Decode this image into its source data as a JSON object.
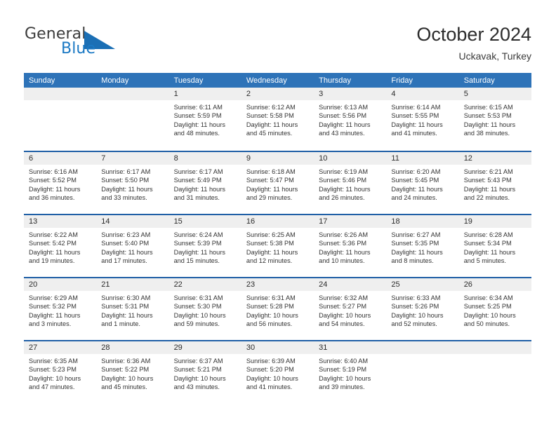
{
  "brand": {
    "name_part1": "General",
    "name_part2": "Blue",
    "logo_icon": "triangle-flag-icon",
    "color_dark": "#3c3c3c",
    "color_blue": "#1b79c4"
  },
  "header": {
    "title": "October 2024",
    "subtitle": "Uckavak, Turkey"
  },
  "theme": {
    "header_bar_bg": "#2E73B8",
    "row_divider": "#1F5FA6",
    "daynum_strip_bg": "#EFEFEF",
    "text": "#333333"
  },
  "calendar": {
    "weekday_headers": [
      "Sunday",
      "Monday",
      "Tuesday",
      "Wednesday",
      "Thursday",
      "Friday",
      "Saturday"
    ],
    "weeks": [
      [
        {
          "day": "",
          "lines": []
        },
        {
          "day": "",
          "lines": []
        },
        {
          "day": "1",
          "lines": [
            "Sunrise: 6:11 AM",
            "Sunset: 5:59 PM",
            "Daylight: 11 hours",
            "and 48 minutes."
          ]
        },
        {
          "day": "2",
          "lines": [
            "Sunrise: 6:12 AM",
            "Sunset: 5:58 PM",
            "Daylight: 11 hours",
            "and 45 minutes."
          ]
        },
        {
          "day": "3",
          "lines": [
            "Sunrise: 6:13 AM",
            "Sunset: 5:56 PM",
            "Daylight: 11 hours",
            "and 43 minutes."
          ]
        },
        {
          "day": "4",
          "lines": [
            "Sunrise: 6:14 AM",
            "Sunset: 5:55 PM",
            "Daylight: 11 hours",
            "and 41 minutes."
          ]
        },
        {
          "day": "5",
          "lines": [
            "Sunrise: 6:15 AM",
            "Sunset: 5:53 PM",
            "Daylight: 11 hours",
            "and 38 minutes."
          ]
        }
      ],
      [
        {
          "day": "6",
          "lines": [
            "Sunrise: 6:16 AM",
            "Sunset: 5:52 PM",
            "Daylight: 11 hours",
            "and 36 minutes."
          ]
        },
        {
          "day": "7",
          "lines": [
            "Sunrise: 6:17 AM",
            "Sunset: 5:50 PM",
            "Daylight: 11 hours",
            "and 33 minutes."
          ]
        },
        {
          "day": "8",
          "lines": [
            "Sunrise: 6:17 AM",
            "Sunset: 5:49 PM",
            "Daylight: 11 hours",
            "and 31 minutes."
          ]
        },
        {
          "day": "9",
          "lines": [
            "Sunrise: 6:18 AM",
            "Sunset: 5:47 PM",
            "Daylight: 11 hours",
            "and 29 minutes."
          ]
        },
        {
          "day": "10",
          "lines": [
            "Sunrise: 6:19 AM",
            "Sunset: 5:46 PM",
            "Daylight: 11 hours",
            "and 26 minutes."
          ]
        },
        {
          "day": "11",
          "lines": [
            "Sunrise: 6:20 AM",
            "Sunset: 5:45 PM",
            "Daylight: 11 hours",
            "and 24 minutes."
          ]
        },
        {
          "day": "12",
          "lines": [
            "Sunrise: 6:21 AM",
            "Sunset: 5:43 PM",
            "Daylight: 11 hours",
            "and 22 minutes."
          ]
        }
      ],
      [
        {
          "day": "13",
          "lines": [
            "Sunrise: 6:22 AM",
            "Sunset: 5:42 PM",
            "Daylight: 11 hours",
            "and 19 minutes."
          ]
        },
        {
          "day": "14",
          "lines": [
            "Sunrise: 6:23 AM",
            "Sunset: 5:40 PM",
            "Daylight: 11 hours",
            "and 17 minutes."
          ]
        },
        {
          "day": "15",
          "lines": [
            "Sunrise: 6:24 AM",
            "Sunset: 5:39 PM",
            "Daylight: 11 hours",
            "and 15 minutes."
          ]
        },
        {
          "day": "16",
          "lines": [
            "Sunrise: 6:25 AM",
            "Sunset: 5:38 PM",
            "Daylight: 11 hours",
            "and 12 minutes."
          ]
        },
        {
          "day": "17",
          "lines": [
            "Sunrise: 6:26 AM",
            "Sunset: 5:36 PM",
            "Daylight: 11 hours",
            "and 10 minutes."
          ]
        },
        {
          "day": "18",
          "lines": [
            "Sunrise: 6:27 AM",
            "Sunset: 5:35 PM",
            "Daylight: 11 hours",
            "and 8 minutes."
          ]
        },
        {
          "day": "19",
          "lines": [
            "Sunrise: 6:28 AM",
            "Sunset: 5:34 PM",
            "Daylight: 11 hours",
            "and 5 minutes."
          ]
        }
      ],
      [
        {
          "day": "20",
          "lines": [
            "Sunrise: 6:29 AM",
            "Sunset: 5:32 PM",
            "Daylight: 11 hours",
            "and 3 minutes."
          ]
        },
        {
          "day": "21",
          "lines": [
            "Sunrise: 6:30 AM",
            "Sunset: 5:31 PM",
            "Daylight: 11 hours",
            "and 1 minute."
          ]
        },
        {
          "day": "22",
          "lines": [
            "Sunrise: 6:31 AM",
            "Sunset: 5:30 PM",
            "Daylight: 10 hours",
            "and 59 minutes."
          ]
        },
        {
          "day": "23",
          "lines": [
            "Sunrise: 6:31 AM",
            "Sunset: 5:28 PM",
            "Daylight: 10 hours",
            "and 56 minutes."
          ]
        },
        {
          "day": "24",
          "lines": [
            "Sunrise: 6:32 AM",
            "Sunset: 5:27 PM",
            "Daylight: 10 hours",
            "and 54 minutes."
          ]
        },
        {
          "day": "25",
          "lines": [
            "Sunrise: 6:33 AM",
            "Sunset: 5:26 PM",
            "Daylight: 10 hours",
            "and 52 minutes."
          ]
        },
        {
          "day": "26",
          "lines": [
            "Sunrise: 6:34 AM",
            "Sunset: 5:25 PM",
            "Daylight: 10 hours",
            "and 50 minutes."
          ]
        }
      ],
      [
        {
          "day": "27",
          "lines": [
            "Sunrise: 6:35 AM",
            "Sunset: 5:23 PM",
            "Daylight: 10 hours",
            "and 47 minutes."
          ]
        },
        {
          "day": "28",
          "lines": [
            "Sunrise: 6:36 AM",
            "Sunset: 5:22 PM",
            "Daylight: 10 hours",
            "and 45 minutes."
          ]
        },
        {
          "day": "29",
          "lines": [
            "Sunrise: 6:37 AM",
            "Sunset: 5:21 PM",
            "Daylight: 10 hours",
            "and 43 minutes."
          ]
        },
        {
          "day": "30",
          "lines": [
            "Sunrise: 6:39 AM",
            "Sunset: 5:20 PM",
            "Daylight: 10 hours",
            "and 41 minutes."
          ]
        },
        {
          "day": "31",
          "lines": [
            "Sunrise: 6:40 AM",
            "Sunset: 5:19 PM",
            "Daylight: 10 hours",
            "and 39 minutes."
          ]
        },
        {
          "day": "",
          "lines": []
        },
        {
          "day": "",
          "lines": []
        }
      ]
    ]
  }
}
